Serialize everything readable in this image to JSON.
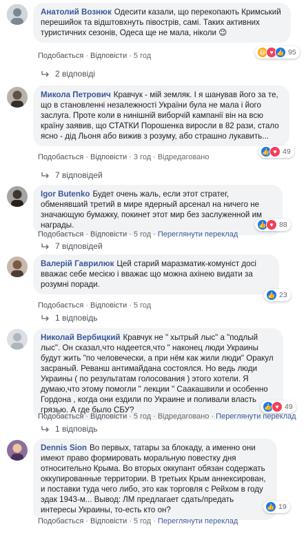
{
  "comments": [
    {
      "author": "Анатолий Вознюк",
      "text": "Одесити казали, що перекопають Кримський перешийок та відштовхнуть півострів, самі. Таких активних туристичних сезонів, Одеса ще не мала, ніколи 😉",
      "reaction_count": "95",
      "like_label": "Подобається",
      "reply_label": "Відповісти",
      "time": "5 год",
      "edited": "",
      "translate": "",
      "replies_label": "2 відповіді"
    },
    {
      "author": "Микола Петрович",
      "text": "Кравчук - мій земляк. І я шанував його за те, що в становленні незалежності України була не мала і його заслуга. Проте коли в нинішній виборчій кампанії він на всю країну заявив, що СТАТКИ Порошенка виросли в 82 рази, стало ясно - дід Льоня або вижив з розуму, або страшно лукавить...",
      "reaction_count": "49",
      "like_label": "Подобається",
      "reply_label": "Відповісти",
      "time": "3 год",
      "edited": "Відредаговано",
      "translate": "",
      "replies_label": "7 відповідей"
    },
    {
      "author": "Igor Butenko",
      "text": "Будет очень жаль, если этот стратег, обменявший третий в мире ядерный арсенал на ничего не значающую бумажку, покинет этот мир без заслуженной им награды.",
      "reaction_count": "88",
      "like_label": "Подобається",
      "reply_label": "Відповісти",
      "time": "5 год",
      "edited": "",
      "translate": "Переглянути переклад",
      "replies_label": "7 відповідей"
    },
    {
      "author": "Валерій Гаврилюк",
      "text": "Цей старий маразматик-комуніст досі вважає себе месією і вважає що можна ахінею видати за розумні поради.",
      "reaction_count": "23",
      "like_label": "Подобається",
      "reply_label": "Відповісти",
      "time": "5 год",
      "edited": "",
      "translate": "",
      "replies_label": "1 відповідь"
    },
    {
      "author": "Николай Вербицкий",
      "text": "Кравчук не \" хытрый лыс\" а \"подлый лыс\". Он сказал,что надеется,что \" наконец люди Украины будут жить \"по человечески, а при нём как жили люди\" Оракул засраный. Реванш антимайдана состоялся. Но ведь люди Украины ( по результатам голосования ) этого хотели. Я думаю,что этому помогли \" лекции \" Саакашвили и особенно Гордона , когда они ездили по Украине и поливали власть грязью. А где было СБУ?",
      "reaction_count": "49",
      "like_label": "Подобається",
      "reply_label": "Відповісти",
      "time": "5 год",
      "edited": "Відредаговано",
      "translate": "Переглянути переклад",
      "replies_label": "1 відповідь"
    },
    {
      "author": "Dennis Sion",
      "text": "Во первых, татары за блокаду, а именно они имеют право формировать моральную повестку дня относительно Крыма. Во вторых оккупант обязан содержать оккупированные территории. В третьих Крым аннексирован, и поставки туда чего либо, это как торговля с Рейхом в году эдак 1943-м... Вывод: ЛМ предлагает сдать/предать интересы Украины, то-есть кто он?",
      "reaction_count": "19",
      "like_label": "Подобається",
      "reply_label": "Відповісти",
      "time": "5 год",
      "edited": "",
      "translate": "Переглянути переклад",
      "replies_label": ""
    }
  ],
  "colors": {
    "link": "#385898",
    "bubble": "#f2f3f5",
    "like": "#1877f2",
    "love": "#f33e58",
    "haha": "#f7b125"
  }
}
